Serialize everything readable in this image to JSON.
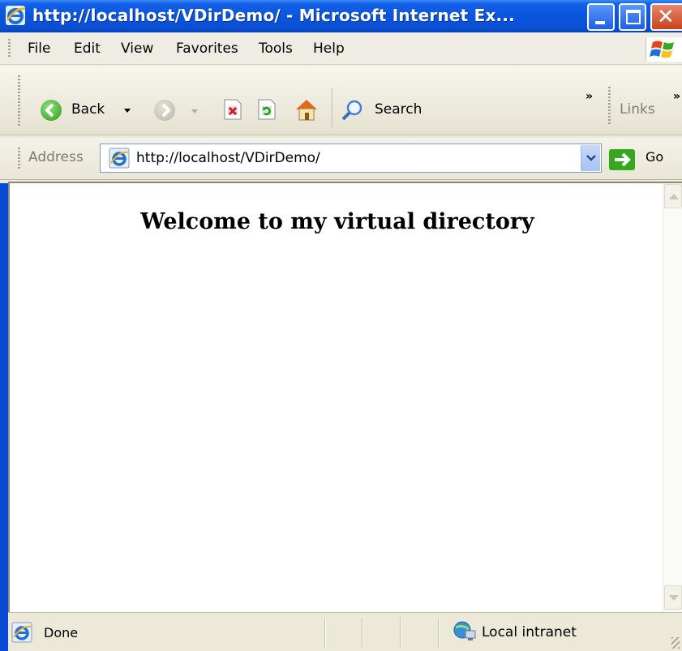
{
  "window": {
    "title": "http://localhost/VDirDemo/ - Microsoft Internet Ex...",
    "controls": {
      "minimize": "minimize",
      "maximize": "maximize",
      "close": "close"
    }
  },
  "menubar": {
    "items": [
      {
        "label": "File"
      },
      {
        "label": "Edit"
      },
      {
        "label": "View"
      },
      {
        "label": "Favorites"
      },
      {
        "label": "Tools"
      },
      {
        "label": "Help"
      }
    ]
  },
  "toolbar": {
    "back_label": "Back",
    "search_label": "Search",
    "links_label": "Links",
    "overflow_glyph": "»"
  },
  "address": {
    "label": "Address",
    "url": "http://localhost/VDirDemo/",
    "go_label": "Go"
  },
  "content": {
    "heading": "Welcome to my virtual directory"
  },
  "status": {
    "text": "Done",
    "zone": "Local intranet"
  },
  "colors": {
    "titlebar": "#0a55de",
    "chrome": "#ece9d8",
    "go_green": "#35a81e"
  }
}
